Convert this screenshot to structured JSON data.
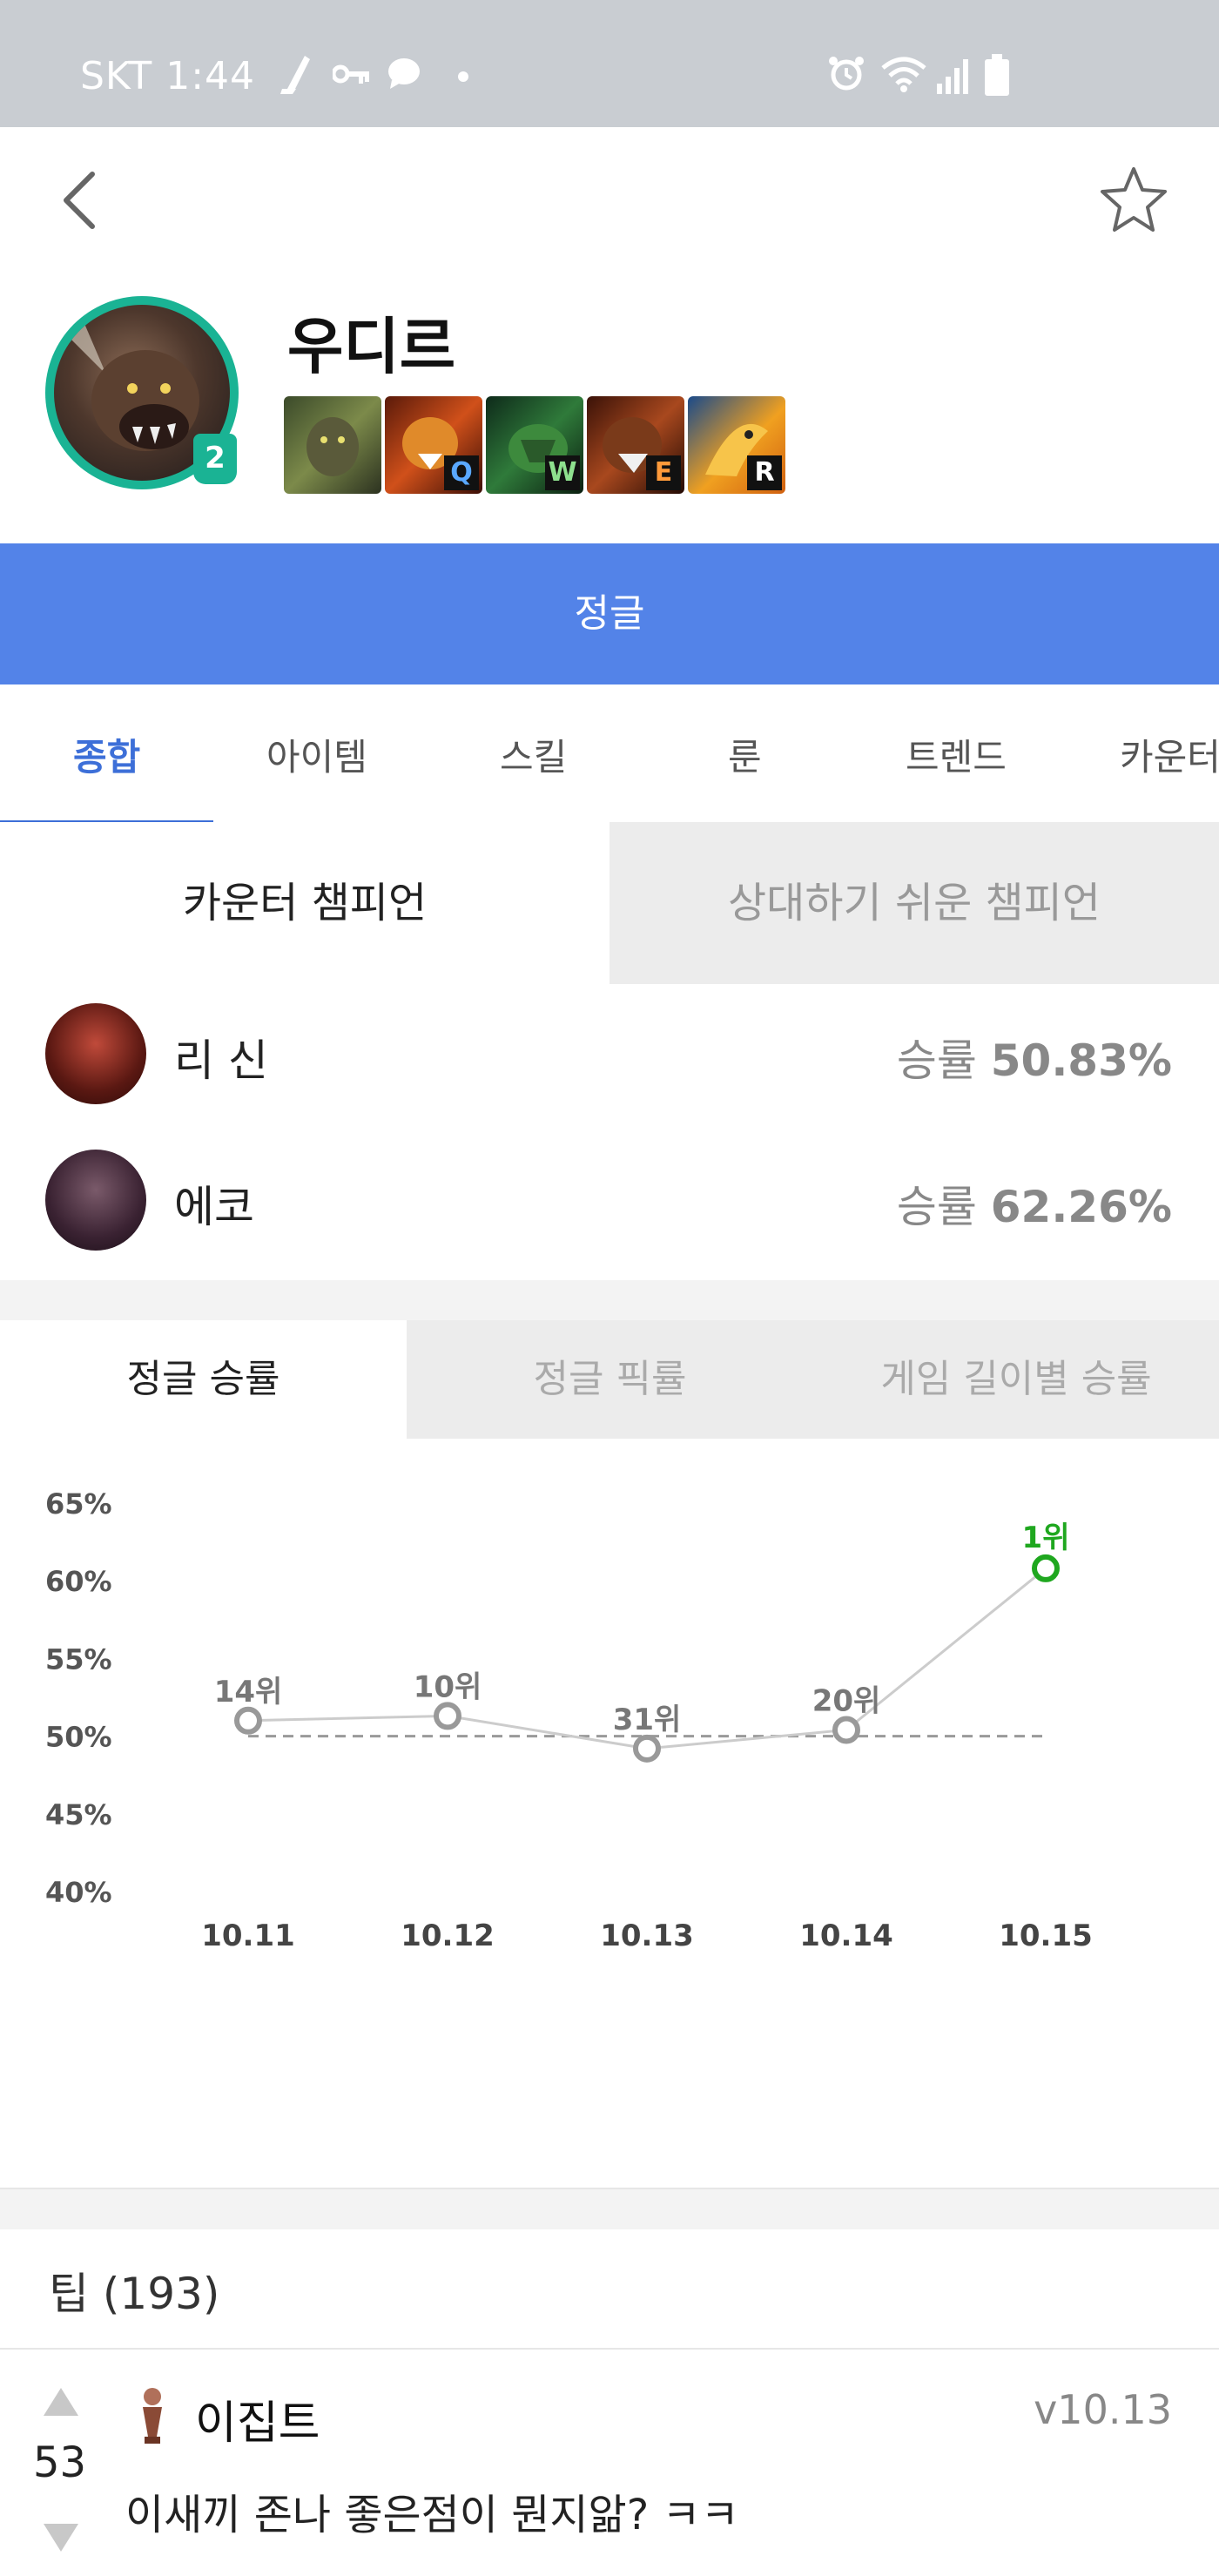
{
  "status_bar": {
    "time": "SKT 1:44",
    "icons": [
      "cleaner-icon",
      "key-icon",
      "chat-icon",
      "dot-icon",
      "alarm-icon",
      "wifi-icon",
      "signal-icon",
      "battery-icon"
    ]
  },
  "header": {
    "champion_name": "우디르",
    "level_badge": "2",
    "skills": [
      {
        "key": "",
        "name": "passive"
      },
      {
        "key": "Q",
        "name": "tiger"
      },
      {
        "key": "W",
        "name": "turtle"
      },
      {
        "key": "E",
        "name": "bear"
      },
      {
        "key": "R",
        "name": "phoenix"
      }
    ]
  },
  "position": "정글",
  "tabs": [
    "종합",
    "아이템",
    "스킬",
    "룬",
    "트렌드",
    "카운터"
  ],
  "active_tab": "종합",
  "counter_section": {
    "segments": [
      "카운터 챔피언",
      "상대하기 쉬운 챔피언"
    ],
    "rows": [
      {
        "name": "리 신",
        "rate_label": "승률",
        "rate": "50.83%"
      },
      {
        "name": "에코",
        "rate_label": "승률",
        "rate": "62.26%"
      }
    ]
  },
  "chart_tabs": [
    "정글 승률",
    "정글 픽률",
    "게임 길이별 승률"
  ],
  "chart_data": {
    "type": "line",
    "title": "",
    "xlabel": "",
    "ylabel": "",
    "categories": [
      "10.11",
      "10.12",
      "10.13",
      "10.14",
      "10.15"
    ],
    "y_tick_labels": [
      "65%",
      "60%",
      "55%",
      "50%",
      "45%",
      "40%"
    ],
    "ylim": [
      40,
      65
    ],
    "baseline": 50,
    "series": [
      {
        "values": [
          51.0,
          51.3,
          49.2,
          50.4,
          60.8
        ],
        "rank_labels": [
          "14위",
          "10위",
          "31위",
          "20위",
          "1위"
        ]
      }
    ],
    "colors": {
      "line": "#cccccc",
      "point": "#999999",
      "highlight": "#1fa71f",
      "baseline": "#999999"
    },
    "grid": false,
    "legend": "none"
  },
  "tips": {
    "header": "팁 (193)",
    "items": [
      {
        "votes": "53",
        "author": "이집트",
        "version": "v10.13",
        "text": "이새끼 존나 좋은점이 뭔지앎? ㅋㅋ"
      }
    ]
  }
}
